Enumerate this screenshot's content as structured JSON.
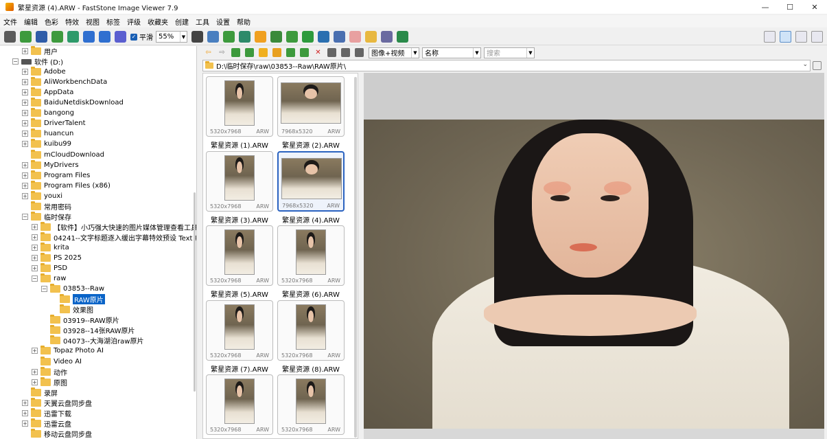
{
  "window": {
    "title": "繁星资源 (4).ARW  -  FastStone Image Viewer 7.9",
    "minimize": "—",
    "maximize": "☐",
    "close": "✕"
  },
  "menu": [
    "文件",
    "编辑",
    "色彩",
    "特效",
    "视图",
    "标签",
    "评级",
    "收藏夹",
    "创建",
    "工具",
    "设置",
    "帮助"
  ],
  "toolbar": {
    "smooth_label": "平滑",
    "zoom_value": "55%",
    "icons": [
      "open-folder-icon",
      "folder-icon",
      "save-icon",
      "save-as-icon",
      "export-icon",
      "zoom-in-icon",
      "zoom-out-icon",
      "actual-size-icon"
    ],
    "icons2": [
      "hand-tool-icon",
      "crop-icon",
      "resize-icon",
      "color-icon",
      "brightness-icon",
      "portrait-icon",
      "rotate-left-icon",
      "rotate-right-icon",
      "compare-icon",
      "slideshow-icon",
      "draw-icon",
      "email-icon",
      "print-icon",
      "batch-icon"
    ]
  },
  "tree": [
    {
      "label": "用户",
      "indent": 1,
      "exp": "+",
      "kind": "folder"
    },
    {
      "label": "软件 (D:)",
      "indent": 0,
      "exp": "-",
      "kind": "drive"
    },
    {
      "label": "Adobe",
      "indent": 1,
      "exp": "+",
      "kind": "folder"
    },
    {
      "label": "AliWorkbenchData",
      "indent": 1,
      "exp": "+",
      "kind": "folder"
    },
    {
      "label": "AppData",
      "indent": 1,
      "exp": "+",
      "kind": "folder"
    },
    {
      "label": "BaiduNetdiskDownload",
      "indent": 1,
      "exp": "+",
      "kind": "folder"
    },
    {
      "label": "bangong",
      "indent": 1,
      "exp": "+",
      "kind": "folder"
    },
    {
      "label": "DriverTalent",
      "indent": 1,
      "exp": "+",
      "kind": "folder"
    },
    {
      "label": "huancun",
      "indent": 1,
      "exp": "+",
      "kind": "folder"
    },
    {
      "label": "kuibu99",
      "indent": 1,
      "exp": "+",
      "kind": "folder"
    },
    {
      "label": "mCloudDownload",
      "indent": 1,
      "exp": "",
      "kind": "folder"
    },
    {
      "label": "MyDrivers",
      "indent": 1,
      "exp": "+",
      "kind": "folder"
    },
    {
      "label": "Program Files",
      "indent": 1,
      "exp": "+",
      "kind": "folder"
    },
    {
      "label": "Program Files (x86)",
      "indent": 1,
      "exp": "+",
      "kind": "folder"
    },
    {
      "label": "youxi",
      "indent": 1,
      "exp": "+",
      "kind": "folder"
    },
    {
      "label": "常用密码",
      "indent": 1,
      "exp": "",
      "kind": "folder"
    },
    {
      "label": "临时保存",
      "indent": 1,
      "exp": "-",
      "kind": "folder"
    },
    {
      "label": "【软件】小巧强大快速的图片媒体管理查看工具 Fa",
      "indent": 2,
      "exp": "+",
      "kind": "folder"
    },
    {
      "label": "04241--文字标题逐入缓出字幕特效预设 Text Pres",
      "indent": 2,
      "exp": "+",
      "kind": "folder"
    },
    {
      "label": "krita",
      "indent": 2,
      "exp": "+",
      "kind": "folder"
    },
    {
      "label": "PS 2025",
      "indent": 2,
      "exp": "+",
      "kind": "folder"
    },
    {
      "label": "PSD",
      "indent": 2,
      "exp": "+",
      "kind": "folder"
    },
    {
      "label": "raw",
      "indent": 2,
      "exp": "-",
      "kind": "folder"
    },
    {
      "label": "03853--Raw",
      "indent": 3,
      "exp": "-",
      "kind": "folder"
    },
    {
      "label": "RAW原片",
      "indent": 4,
      "exp": "",
      "kind": "folder",
      "selected": true
    },
    {
      "label": "效果图",
      "indent": 4,
      "exp": "",
      "kind": "folder"
    },
    {
      "label": "03919--RAW原片",
      "indent": 3,
      "exp": "",
      "kind": "folder"
    },
    {
      "label": "03928--14张RAW原片",
      "indent": 3,
      "exp": "",
      "kind": "folder"
    },
    {
      "label": "04073--大海湖泊raw原片",
      "indent": 3,
      "exp": "",
      "kind": "folder"
    },
    {
      "label": "Topaz Photo AI",
      "indent": 2,
      "exp": "+",
      "kind": "folder"
    },
    {
      "label": "Video AI",
      "indent": 2,
      "exp": "",
      "kind": "folder"
    },
    {
      "label": "动作",
      "indent": 2,
      "exp": "+",
      "kind": "folder"
    },
    {
      "label": "原图",
      "indent": 2,
      "exp": "+",
      "kind": "folder"
    },
    {
      "label": "录屏",
      "indent": 1,
      "exp": "",
      "kind": "folder"
    },
    {
      "label": "天翼云盘同步盘",
      "indent": 1,
      "exp": "+",
      "kind": "folder"
    },
    {
      "label": "迅雷下载",
      "indent": 1,
      "exp": "+",
      "kind": "folder"
    },
    {
      "label": "迅雷云盘",
      "indent": 1,
      "exp": "+",
      "kind": "folder"
    },
    {
      "label": "移动云盘同步盘",
      "indent": 1,
      "exp": "",
      "kind": "folder"
    }
  ],
  "nav": {
    "filter_value": "图像+视频",
    "sort_value": "名称",
    "search_placeholder": "搜索",
    "icons": [
      "back-icon",
      "forward-icon",
      "up-folder-icon",
      "folder-green-icon",
      "folder-yellow-icon",
      "folder-open-icon",
      "folder-refresh-icon",
      "folder-add-icon",
      "delete-icon",
      "thumb-view-icon",
      "list-view-icon",
      "detail-view-icon"
    ]
  },
  "path": "D:\\临时保存\\raw\\03853--Raw\\RAW原片\\",
  "thumbnails": [
    {
      "name": "繁星资源 (1).ARW",
      "dims": "5320x7968",
      "ext": "ARW",
      "orientation": "portrait"
    },
    {
      "name": "繁星资源 (2).ARW",
      "dims": "7968x5320",
      "ext": "ARW",
      "orientation": "landscape"
    },
    {
      "name": "繁星资源 (3).ARW",
      "dims": "5320x7968",
      "ext": "ARW",
      "orientation": "portrait"
    },
    {
      "name": "繁星资源 (4).ARW",
      "dims": "7968x5320",
      "ext": "ARW",
      "orientation": "landscape",
      "selected": true
    },
    {
      "name": "繁星资源 (5).ARW",
      "dims": "5320x7968",
      "ext": "ARW",
      "orientation": "portrait"
    },
    {
      "name": "繁星资源 (6).ARW",
      "dims": "5320x7968",
      "ext": "ARW",
      "orientation": "portrait"
    },
    {
      "name": "繁星资源 (7).ARW",
      "dims": "5320x7968",
      "ext": "ARW",
      "orientation": "portrait"
    },
    {
      "name": "繁星资源 (8).ARW",
      "dims": "5320x7968",
      "ext": "ARW",
      "orientation": "portrait"
    },
    {
      "name": "",
      "dims": "5320x7968",
      "ext": "ARW",
      "orientation": "portrait"
    },
    {
      "name": "",
      "dims": "5320x7968",
      "ext": "ARW",
      "orientation": "portrait"
    }
  ],
  "colors": {
    "accent": "#0a64c8",
    "selection_border": "#2a62c0",
    "folder": "#f2c14e"
  }
}
